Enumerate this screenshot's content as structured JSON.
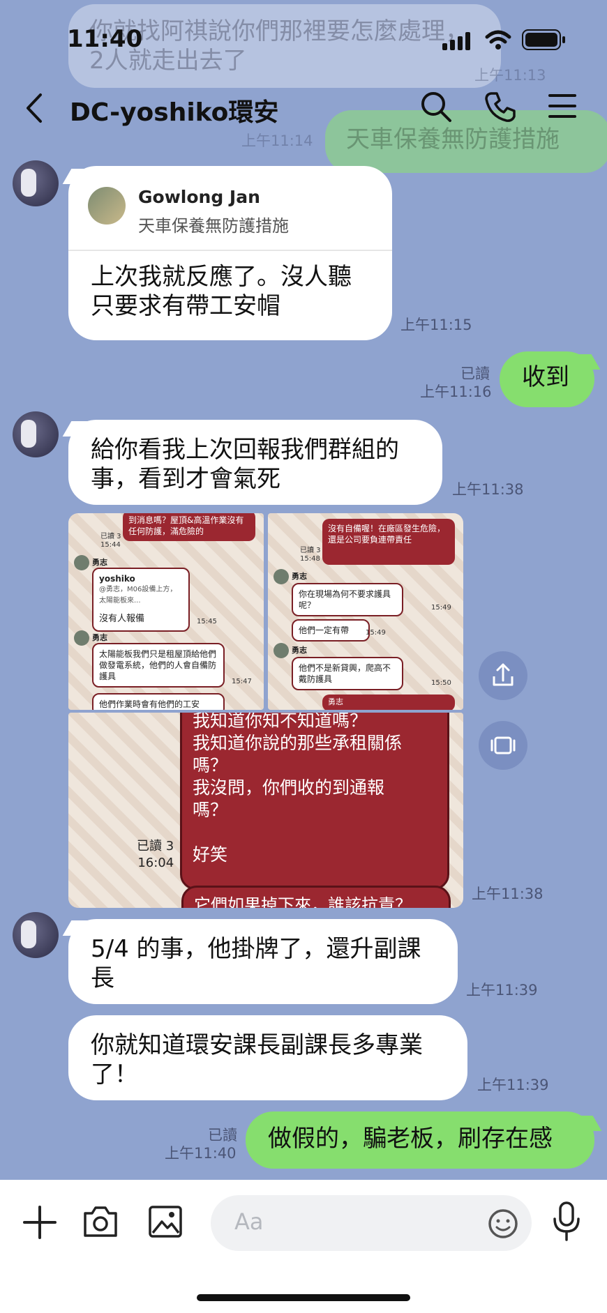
{
  "status_bar": {
    "time": "11:40"
  },
  "background_ghost": {
    "prev_text": "你就找阿祺說你們那裡要怎麼處理，2人就走出去了",
    "prev_time": "上午11:13",
    "prev_green_text": "天車保養無防護措施",
    "prev_green_time": "上午11:14"
  },
  "header": {
    "title": "DC-yoshiko環安"
  },
  "messages": [
    {
      "id": "m1",
      "side": "left",
      "reply_to": {
        "name": "Gowlong Jan",
        "text": "天車保養無防護措施"
      },
      "text_line1": "上次我就反應了。沒人聽",
      "text_line2": "只要求有帶工安帽",
      "time": "上午11:15"
    },
    {
      "id": "m2",
      "side": "right",
      "text": "收到",
      "read": "已讀",
      "time": "上午11:16"
    },
    {
      "id": "m3",
      "side": "left",
      "text_line1": "給你看我上次回報我們群組的",
      "text_line2": "事，看到才會氣死",
      "time": "上午11:38"
    },
    {
      "id": "m4",
      "side": "left",
      "type": "photos",
      "time": "上午11:38",
      "photo1": {
        "top_red": "到消息嗎？屋頂&高溫作業沒有任何防護，滿危險的",
        "read_a": "已讀 3",
        "time_a": "15:44",
        "name": "勇志",
        "quote_name": "yoshiko",
        "quote_text": "@勇志，M06設備上方，太陽能板來...",
        "reply1": "沒有人報備",
        "reply1_time": "15:45",
        "name2": "勇志",
        "reply2": "太陽能板我們只是租屋頂給他們做發電系統，他們的人會自備防護具",
        "reply2_time": "15:47",
        "reply3": "他們作業時會有他們的工安"
      },
      "photo2": {
        "top_red": "沒有自備喔！在廠區發生危險，還是公司要負連帶責任",
        "read_a": "已讀 3",
        "time_a": "15:48",
        "name": "勇志",
        "reply1": "你在現場為何不要求護具呢？",
        "reply1_time": "15:49",
        "reply2": "他們一定有帶",
        "reply2_time": "15:49",
        "name2": "勇志",
        "reply3": "他們不是新貸興，爬高不戴防護具",
        "reply3_time": "15:50",
        "name3": "勇志"
      },
      "photo3": {
        "red_text": "我知道你知不知道嗎？\n我知道你說的那些承租關係嗎？\n我沒問，你們收的到通報嗎？\n\n好笑",
        "read": "已讀 3",
        "time": "16:04",
        "bottom_red": "它們如果掉下來，誰該抗責？"
      }
    },
    {
      "id": "m5",
      "side": "left",
      "text_line1": "5/4 的事，他掛牌了，還升副課",
      "text_line2": "長",
      "time": "上午11:39"
    },
    {
      "id": "m6",
      "side": "left",
      "text_line1": "你就知道環安課長副課長多專業",
      "text_line2": "了！",
      "time": "上午11:39"
    },
    {
      "id": "m7",
      "side": "right",
      "text": "做假的，騙老板，刷存在感",
      "read": "已讀",
      "time": "上午11:40"
    }
  ],
  "composer": {
    "placeholder": "Aa"
  },
  "colors": {
    "background": "#8fa3cf",
    "outgoing": "#86de6e",
    "incoming": "#ffffff",
    "photo_red": "#9b2730"
  }
}
